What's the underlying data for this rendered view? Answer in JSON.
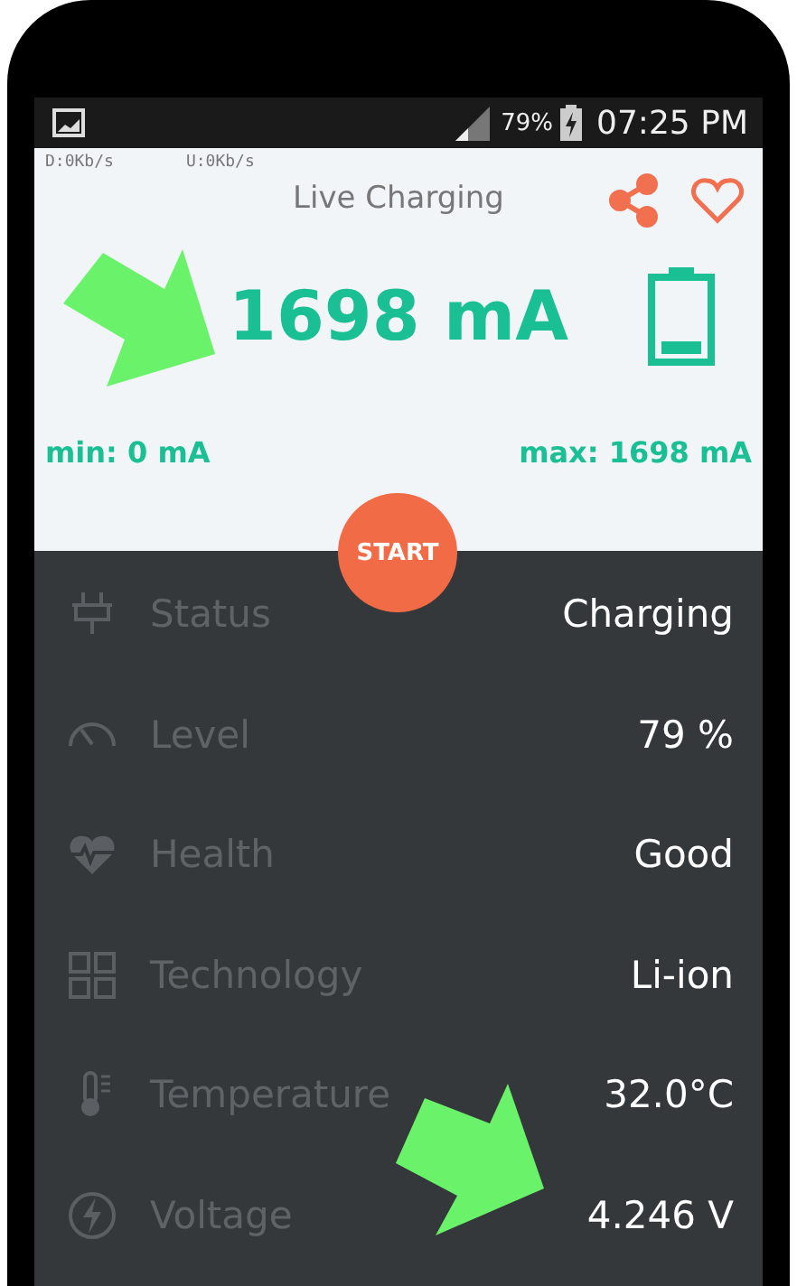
{
  "status_bar": {
    "battery": "79%",
    "time": "07:25 PM"
  },
  "net_speed": {
    "download": "D:0Kb/s",
    "upload": "U:0Kb/s"
  },
  "title": "Live Charging",
  "current": "1698 mA",
  "min": "min: 0 mA",
  "max": "max: 1698 mA",
  "start_button": "START",
  "rows": [
    {
      "label": "Status",
      "value": "Charging"
    },
    {
      "label": "Level",
      "value": "79 %"
    },
    {
      "label": "Health",
      "value": "Good"
    },
    {
      "label": "Technology",
      "value": "Li-ion"
    },
    {
      "label": "Temperature",
      "value": "32.0°C"
    },
    {
      "label": "Voltage",
      "value": "4.246 V"
    }
  ]
}
